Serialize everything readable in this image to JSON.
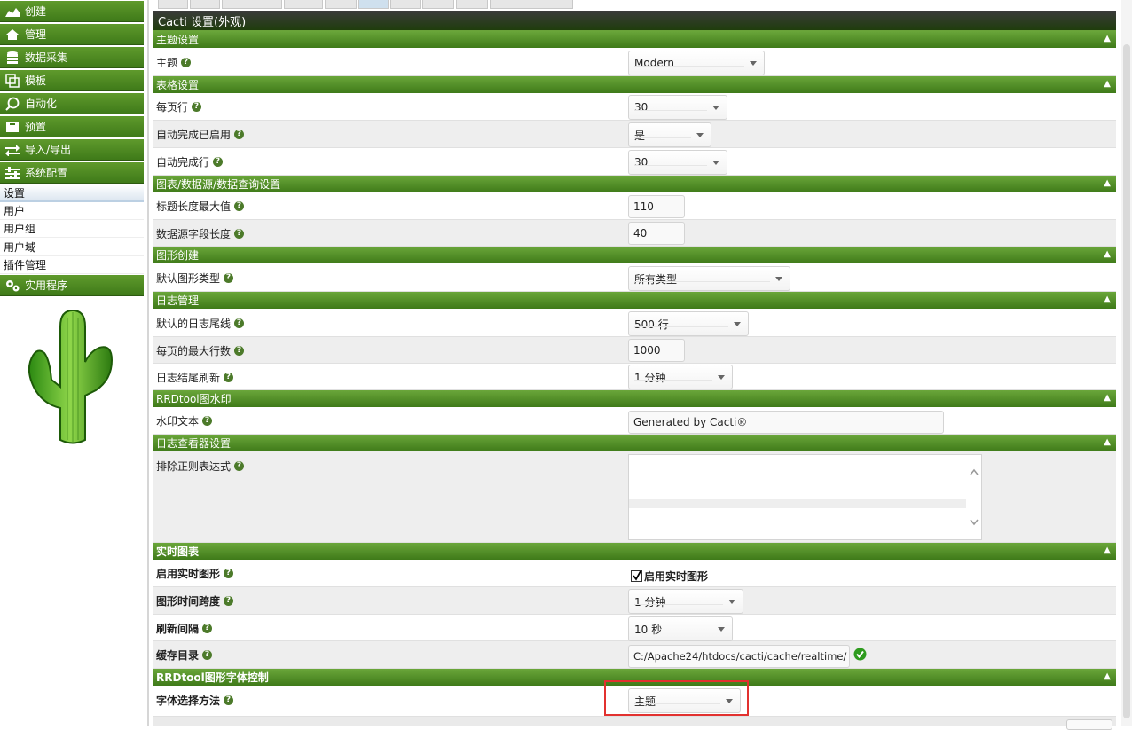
{
  "sidebar": {
    "nav": [
      {
        "label": "创建",
        "icon": "chart-icon"
      },
      {
        "label": "管理",
        "icon": "home-icon"
      },
      {
        "label": "数据采集",
        "icon": "database-icon"
      },
      {
        "label": "模板",
        "icon": "copy-icon"
      },
      {
        "label": "自动化",
        "icon": "automation-icon"
      },
      {
        "label": "预置",
        "icon": "box-icon"
      },
      {
        "label": "导入/导出",
        "icon": "transfer-icon"
      },
      {
        "label": "系统配置",
        "icon": "sliders-icon"
      }
    ],
    "sub_items": [
      "设置",
      "用户",
      "用户组",
      "用户域",
      "插件管理"
    ],
    "utility": {
      "label": "实用程序",
      "icon": "gears-icon"
    },
    "logo": "cactus-logo"
  },
  "page": {
    "title": "Cacti 设置(外观)"
  },
  "sections": {
    "theme": {
      "title": "主题设置"
    },
    "table": {
      "title": "表格设置"
    },
    "graph_ds": {
      "title": "图表/数据源/数据查询设置"
    },
    "graph_create": {
      "title": "图形创建"
    },
    "log": {
      "title": "日志管理"
    },
    "watermark": {
      "title": "RRDtool图水印"
    },
    "log_viewer": {
      "title": "日志查看器设置"
    },
    "realtime": {
      "title": "实时图表"
    },
    "font": {
      "title": "RRDtool图形字体控制"
    }
  },
  "fields": {
    "theme": {
      "label": "主题",
      "value": "Modern"
    },
    "rows_per_page": {
      "label": "每页行",
      "value": "30"
    },
    "autocomplete_enabled": {
      "label": "自动完成已启用",
      "value": "是"
    },
    "autocomplete_rows": {
      "label": "自动完成行",
      "value": "30"
    },
    "title_max_len": {
      "label": "标题长度最大值",
      "value": "110"
    },
    "ds_field_len": {
      "label": "数据源字段长度",
      "value": "40"
    },
    "default_graph_type": {
      "label": "默认图形类型",
      "value": "所有类型"
    },
    "log_tail": {
      "label": "默认的日志尾线",
      "value": "500 行"
    },
    "log_max_rows": {
      "label": "每页的最大行数",
      "value": "1000"
    },
    "log_refresh": {
      "label": "日志结尾刷新",
      "value": "1 分钟"
    },
    "watermark_text": {
      "label": "水印文本",
      "value": "Generated by Cacti®"
    },
    "exclude_regex": {
      "label": "排除正则表达式"
    },
    "realtime_enable": {
      "label": "启用实时图形",
      "checkbox_label": "启用实时图形",
      "checked": true
    },
    "graph_timespan": {
      "label": "图形时间跨度",
      "value": "1 分钟"
    },
    "refresh_interval": {
      "label": "刷新间隔",
      "value": "10 秒"
    },
    "cache_dir": {
      "label": "缓存目录",
      "value": "C:/Apache24/htdocs/cacti/cache/realtime/"
    },
    "font_method": {
      "label": "字体选择方法",
      "value": "主题"
    }
  },
  "colors": {
    "accent": "#4c8a22",
    "highlight": "#e2312f"
  }
}
